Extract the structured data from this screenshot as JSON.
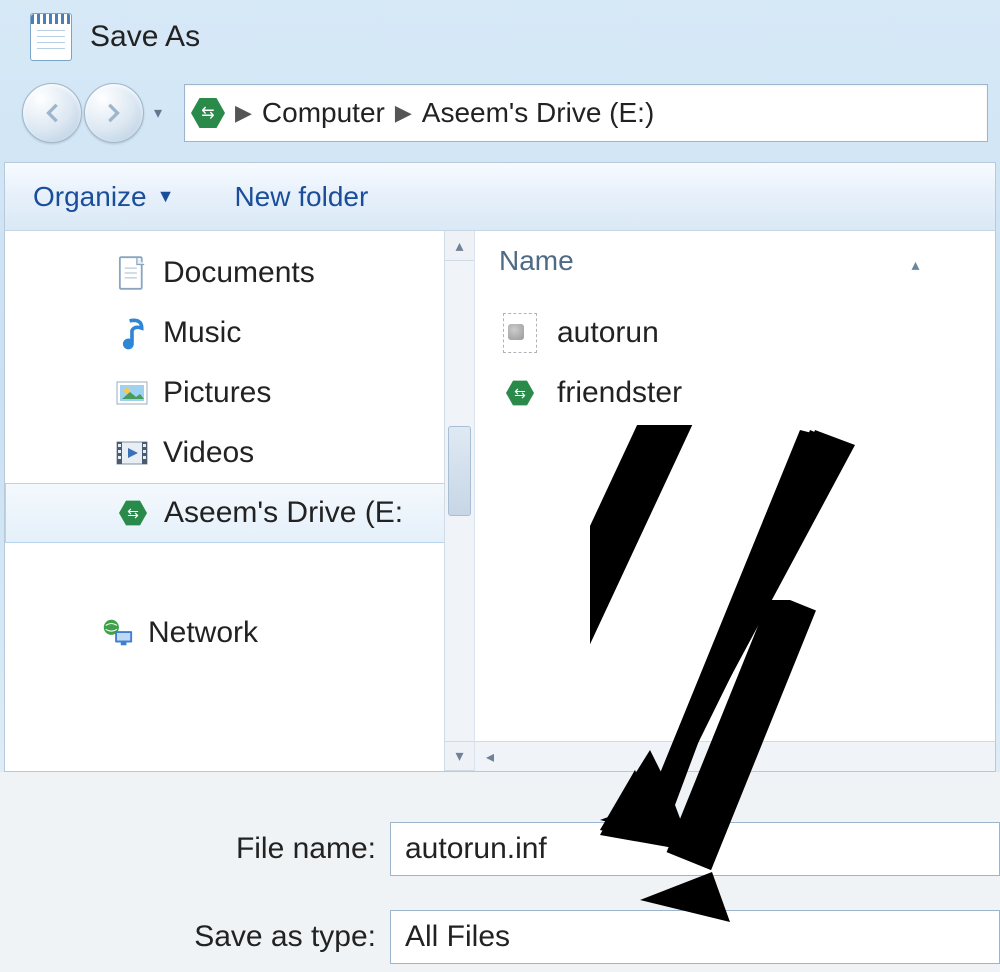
{
  "window": {
    "title": "Save As"
  },
  "breadcrumb": {
    "root": "Computer",
    "path": "Aseem's Drive (E:)"
  },
  "toolbar": {
    "organize": "Organize",
    "new_folder": "New folder"
  },
  "tree": {
    "items": [
      {
        "label": "Documents",
        "icon": "document"
      },
      {
        "label": "Music",
        "icon": "music"
      },
      {
        "label": "Pictures",
        "icon": "pictures"
      },
      {
        "label": "Videos",
        "icon": "videos"
      },
      {
        "label": "Aseem's Drive (E:",
        "icon": "hex",
        "selected": true
      }
    ],
    "network_label": "Network"
  },
  "content": {
    "column_header": "Name",
    "files": [
      {
        "label": "autorun",
        "icon": "inf"
      },
      {
        "label": "friendster",
        "icon": "hex"
      }
    ]
  },
  "form": {
    "filename_label": "File name:",
    "filename_value": "autorun.inf",
    "saveastype_label": "Save as type:",
    "saveastype_value": "All Files"
  }
}
